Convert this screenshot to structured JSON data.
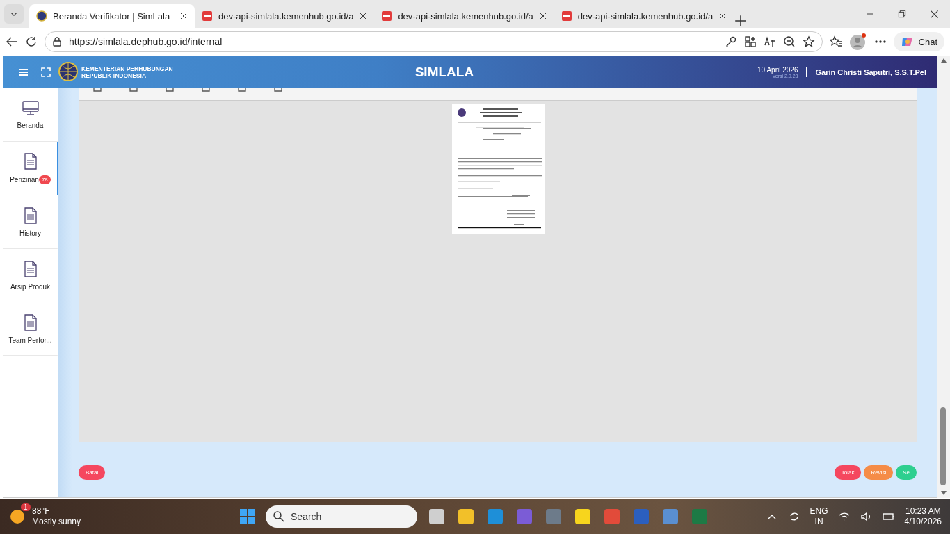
{
  "browser": {
    "tabs": [
      {
        "kind": "site",
        "title": "Beranda Verifikator | SimLala",
        "selected": true
      },
      {
        "kind": "pdf",
        "title": "dev-api-simlala.kemenhub.go.id/a",
        "selected": false
      },
      {
        "kind": "pdf",
        "title": "dev-api-simlala.kemenhub.go.id/a",
        "selected": false
      },
      {
        "kind": "pdf",
        "title": "dev-api-simlala.kemenhub.go.id/a",
        "selected": false
      }
    ],
    "url": "https://simlala.dephub.go.id/internal",
    "chat_label": "Chat"
  },
  "header": {
    "org_line_1": "KEMENTERIAN PERHUBUNGAN",
    "org_line_2": "REPUBLIK INDONESIA",
    "app_title": "SIMLALA",
    "date": "10 April 2026",
    "version": "versi 2.0.23",
    "user": "Garin Christi Saputri, S.S.T.Pel"
  },
  "sidebar": {
    "items": [
      {
        "kind": "monitor",
        "label": "Beranda",
        "selected": false
      },
      {
        "kind": "document",
        "label": "Perizinan",
        "badge": "78",
        "selected": true
      },
      {
        "kind": "document",
        "label": "History",
        "selected": false
      },
      {
        "kind": "document",
        "label": "Arsip Produk",
        "selected": false
      },
      {
        "kind": "document",
        "label": "Team Perfor...",
        "selected": false
      }
    ]
  },
  "footer": {
    "cancel_button": "Batal",
    "actions": [
      {
        "label": "Tolak",
        "color": "#f5475f"
      },
      {
        "label": "Revisi",
        "color": "#f58c47"
      },
      {
        "label": "Se",
        "color": "#2ecf8f"
      }
    ]
  },
  "taskbar": {
    "weather": {
      "badge": "1",
      "temperature": "88°F",
      "condition": "Mostly sunny"
    },
    "search_placeholder": "Search",
    "language": "ENG",
    "region": "IN",
    "time": "10:23 AM",
    "date": "4/10/2026"
  }
}
